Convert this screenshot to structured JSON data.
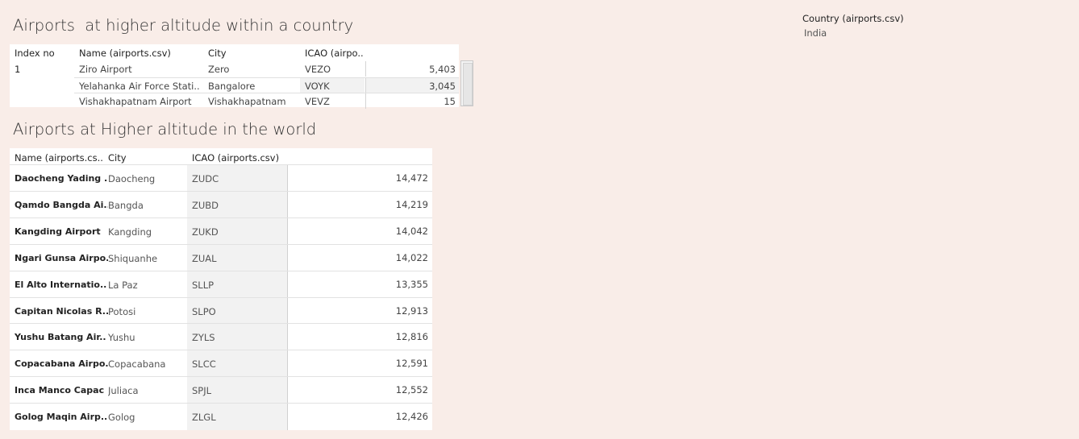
{
  "country_table": {
    "title": "Airports  at higher altitude within a country",
    "headers": [
      "Index no",
      "Name (airports.csv)",
      "City",
      "ICAO (airpo.."
    ],
    "index": "1",
    "rows": [
      {
        "name": "Ziro Airport",
        "city": "Zero",
        "icao": "VEZO",
        "value": "5,403"
      },
      {
        "name": "Yelahanka Air Force Stati..",
        "city": "Bangalore",
        "icao": "VOYK",
        "value": "3,045"
      },
      {
        "name": "Vishakhapatnam Airport",
        "city": "Vishakhapatnam",
        "icao": "VEVZ",
        "value": "15"
      }
    ]
  },
  "world_table": {
    "title": "Airports at Higher altitude in the world",
    "headers": [
      "Name (airports.cs..",
      "City",
      "ICAO (airports.csv)"
    ],
    "rows": [
      {
        "name": "Daocheng Yading ..",
        "city": "Daocheng",
        "icao": "ZUDC",
        "value": "14,472"
      },
      {
        "name": "Qamdo Bangda Ai..",
        "city": "Bangda",
        "icao": "ZUBD",
        "value": "14,219"
      },
      {
        "name": "Kangding Airport",
        "city": "Kangding",
        "icao": "ZUKD",
        "value": "14,042"
      },
      {
        "name": "Ngari Gunsa Airpo..",
        "city": "Shiquanhe",
        "icao": "ZUAL",
        "value": "14,022"
      },
      {
        "name": "El Alto Internatio..",
        "city": "La Paz",
        "icao": "SLLP",
        "value": "13,355"
      },
      {
        "name": "Capitan Nicolas R..",
        "city": "Potosi",
        "icao": "SLPO",
        "value": "12,913"
      },
      {
        "name": "Yushu Batang Air..",
        "city": "Yushu",
        "icao": "ZYLS",
        "value": "12,816"
      },
      {
        "name": "Copacabana Airpo..",
        "city": "Copacabana",
        "icao": "SLCC",
        "value": "12,591"
      },
      {
        "name": "Inca Manco Capac ..",
        "city": "Juliaca",
        "icao": "SPJL",
        "value": "12,552"
      },
      {
        "name": "Golog Maqin Airp..",
        "city": "Golog",
        "icao": "ZLGL",
        "value": "12,426"
      }
    ]
  },
  "filter": {
    "label": "Country (airports.csv)",
    "value": "India"
  },
  "colors": {
    "background": "#f9ede8",
    "band": "#f2f2f2",
    "grid": "#d4d4d4"
  }
}
